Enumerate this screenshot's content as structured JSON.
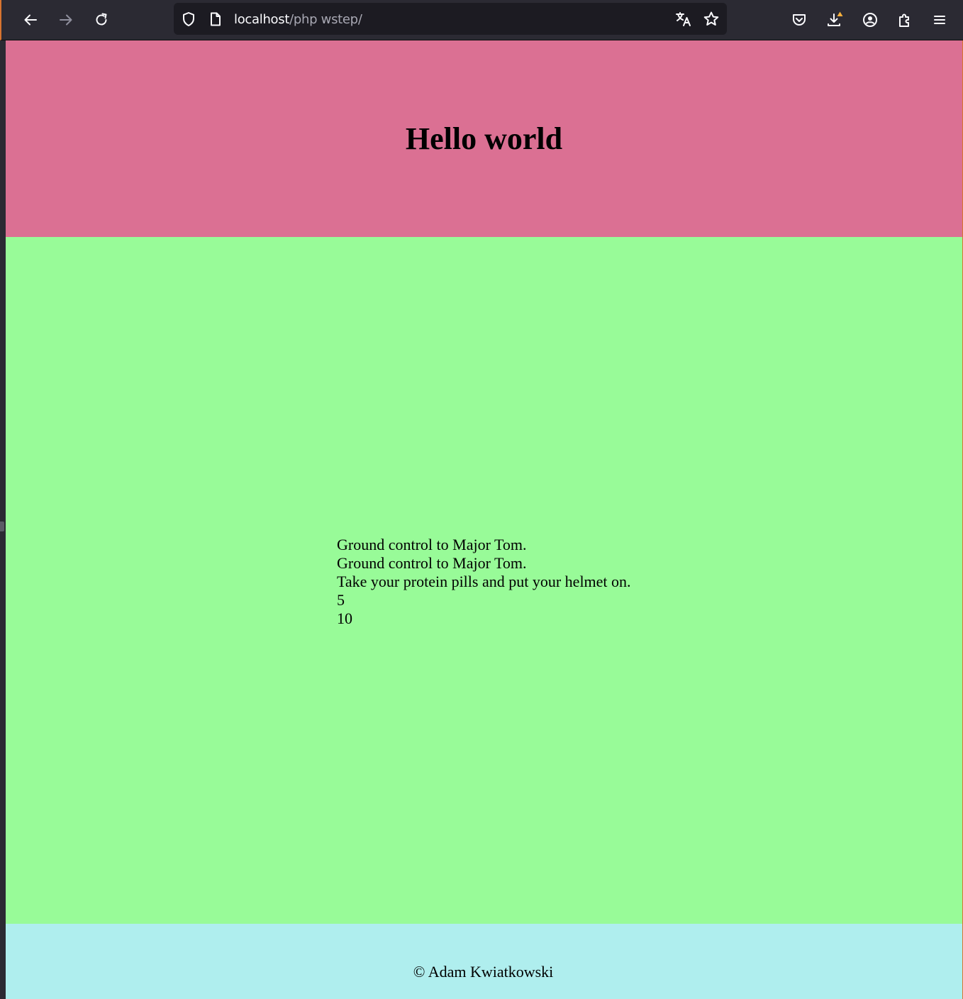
{
  "browser": {
    "url_host": "localhost",
    "url_path": "/php wstep/",
    "colors": {
      "toolbar": "#2b2a33",
      "urlbar": "#1c1b22",
      "accent": "#d8742f",
      "download_badge": "#f9b13c"
    },
    "icons": {
      "back": "arrow-left-icon",
      "forward": "arrow-right-icon",
      "reload": "reload-icon",
      "tracking": "shield-icon",
      "page": "page-icon",
      "translate": "translate-icon",
      "bookmark": "star-icon",
      "pocket": "pocket-icon",
      "downloads": "download-icon",
      "account": "account-icon",
      "extensions": "puzzle-icon",
      "menu": "hamburger-menu-icon"
    }
  },
  "page": {
    "colors": {
      "header": "#db7093",
      "main": "#98fb98",
      "footer": "#afeeee"
    },
    "header": {
      "title": "Hello world"
    },
    "main": {
      "lines": [
        "Ground control to Major Tom.",
        "Ground control to Major Tom.",
        "Take your protein pills and put your helmet on.",
        "5",
        "10"
      ]
    },
    "footer": {
      "text": "© Adam Kwiatkowski"
    }
  }
}
